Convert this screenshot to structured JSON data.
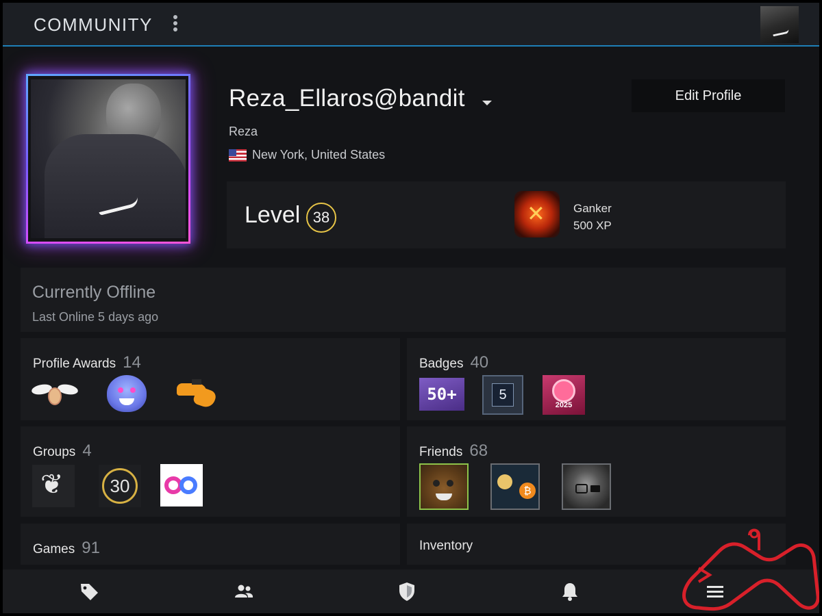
{
  "header": {
    "title": "COMMUNITY",
    "menu_icon": "kebab-icon",
    "avatar_icon": "avatar"
  },
  "profile": {
    "username": "Reza_Ellaros@bandit",
    "real_name": "Reza",
    "location": "New York, United States",
    "flag": "us-flag-icon",
    "edit_button": "Edit Profile"
  },
  "level": {
    "label": "Level",
    "value": "38",
    "featured_badge": {
      "name": "Ganker",
      "xp": "500 XP"
    }
  },
  "status": {
    "title": "Currently Offline",
    "subtitle": "Last Online 5 days ago"
  },
  "sections": {
    "awards": {
      "label": "Profile Awards",
      "count": "14"
    },
    "badges": {
      "label": "Badges",
      "count": "40",
      "items": [
        "50+",
        "5",
        "2025"
      ]
    },
    "groups": {
      "label": "Groups",
      "count": "4",
      "items": [
        "phoenix",
        "30",
        "infinity"
      ]
    },
    "friends": {
      "label": "Friends",
      "count": "68"
    },
    "games": {
      "label": "Games",
      "count": "91"
    },
    "inventory": {
      "label": "Inventory"
    }
  },
  "bottom_nav": [
    {
      "name": "tag-icon"
    },
    {
      "name": "friends-icon"
    },
    {
      "name": "shield-icon"
    },
    {
      "name": "bell-icon"
    },
    {
      "name": "menu-icon"
    }
  ],
  "colors": {
    "accent_blue": "#1e7fb8",
    "level_ring": "#e8c547",
    "panel": "#1a1b1e",
    "background": "#131417",
    "watermark_red": "#d8202a"
  }
}
